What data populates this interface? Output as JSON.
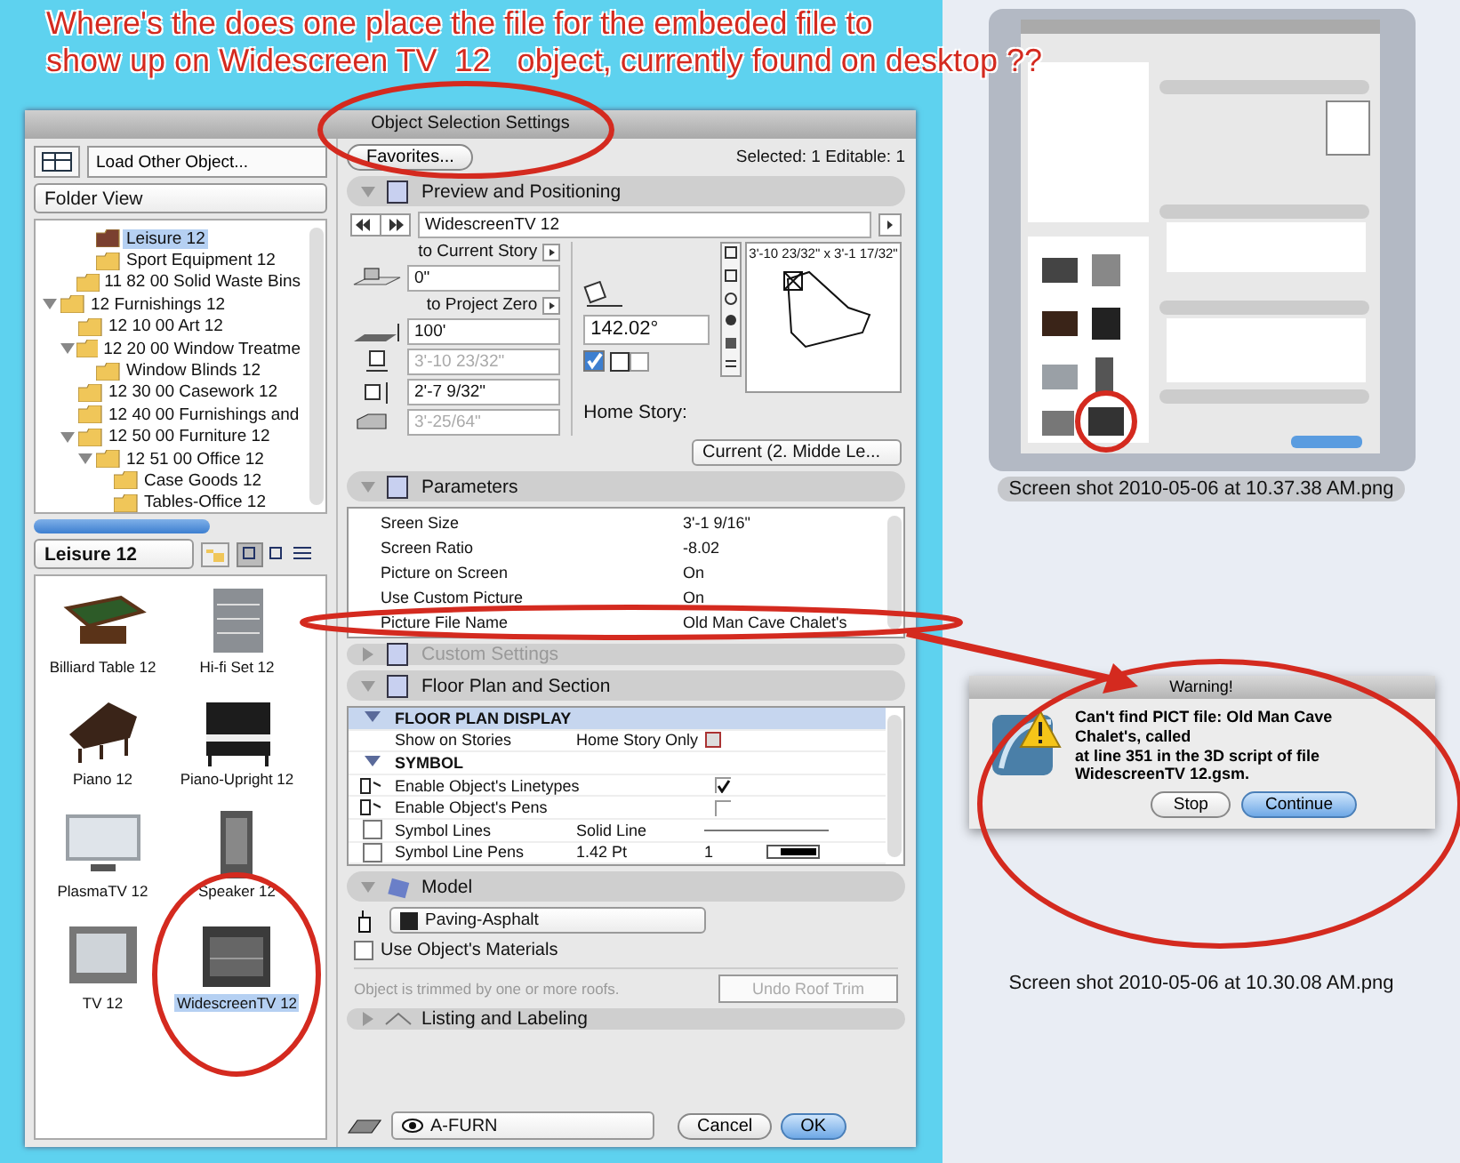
{
  "annotation": {
    "lines": [
      "Where's the does one place the file for the embeded file to",
      "show up on Widescreen TV  12   object, currently found on desktop ??"
    ]
  },
  "dialog": {
    "title": "Object Selection Settings",
    "load_button": "Load Other Object...",
    "view_select": "Folder View",
    "tree": [
      {
        "children": [
          {
            "children": [
              {
                "label": "Leisure 12",
                "kind": "library",
                "selected": true
              },
              {
                "label": "Sport Equipment 12",
                "kind": "folder",
                "selected": false
              }
            ]
          },
          {
            "label": "11 82 00 Solid Waste Bins",
            "kind": "folder",
            "selected": false
          }
        ]
      },
      {
        "label": "12 Furnishings 12",
        "kind": "folder",
        "selected": false,
        "expanded": true,
        "children": [
          {
            "label": "12 10 00 Art 12",
            "kind": "folder",
            "selected": false
          },
          {
            "label": "12 20 00 Window Treatme",
            "kind": "folder",
            "selected": false,
            "expanded": true,
            "children": [
              {
                "label": "Window Blinds 12",
                "kind": "folder",
                "selected": false
              }
            ]
          },
          {
            "label": "12 30 00 Casework 12",
            "kind": "folder",
            "selected": false
          },
          {
            "label": "12 40 00 Furnishings and",
            "kind": "folder",
            "selected": false
          },
          {
            "label": "12 50 00 Furniture 12",
            "kind": "folder",
            "selected": false,
            "expanded": true,
            "children": [
              {
                "label": "12 51 00 Office 12",
                "kind": "folder",
                "selected": false,
                "expanded": true,
                "children": [
                  {
                    "label": "Case Goods 12",
                    "kind": "folder",
                    "selected": false
                  },
                  {
                    "label": "Tables-Office 12",
                    "kind": "folder",
                    "selected": false
                  }
                ]
              }
            ]
          }
        ]
      }
    ],
    "folder_select": "Leisure 12",
    "objects": [
      {
        "label": "Billiard Table 12",
        "kind": "billiard",
        "selected": false
      },
      {
        "label": "Hi-fi Set 12",
        "kind": "hifi",
        "selected": false
      },
      {
        "label": "Piano 12",
        "kind": "piano",
        "selected": false
      },
      {
        "label": "Piano-Upright 12",
        "kind": "upright",
        "selected": false
      },
      {
        "label": "PlasmaTV 12",
        "kind": "plasma",
        "selected": false
      },
      {
        "label": "Speaker 12",
        "kind": "speaker",
        "selected": false
      },
      {
        "label": "TV 12",
        "kind": "tv",
        "selected": false
      },
      {
        "label": "WidescreenTV 12",
        "kind": "widescreen",
        "selected": true
      }
    ],
    "favorites_button": "Favorites...",
    "selection_info": "Selected: 1 Editable: 1",
    "sections": [
      {
        "kind": "preview",
        "title": "Preview and Positioning",
        "expanded": true,
        "disabled": false,
        "object_name": "WidescreenTV 12",
        "story_label": "to Current Story",
        "story_offset": "0\"",
        "zero_label": "to Project Zero",
        "zero_offset": "100'",
        "width": {
          "value": "3'-10 23/32\"",
          "disabled": true
        },
        "depth": {
          "value": "2'-7 9/32\"",
          "disabled": false
        },
        "height": {
          "value": "3'-25/64\"",
          "disabled": true
        },
        "angle": "142.02°",
        "mirrored": true,
        "home_story_label": "Home Story:",
        "home_story": "Current (2. Midde Le...",
        "preview_size": "3'-10 23/32\" x 3'-1 17/32\""
      },
      {
        "kind": "parameters",
        "title": "Parameters",
        "expanded": true,
        "disabled": false,
        "rows": [
          {
            "name": "Sreen Size",
            "value": "3'-1 9/16\""
          },
          {
            "name": "Screen Ratio",
            "value": "-8.02"
          },
          {
            "name": "Picture on Screen",
            "value": "On"
          },
          {
            "name": "Use Custom Picture",
            "value": "On"
          },
          {
            "name": "Picture File Name",
            "value": "Old Man Cave Chalet's"
          }
        ]
      },
      {
        "kind": "custom",
        "title": "Custom Settings",
        "expanded": false,
        "disabled": true
      },
      {
        "kind": "floor_plan",
        "title": "Floor Plan and Section",
        "expanded": true,
        "disabled": false,
        "rows": [
          {
            "kind": "group",
            "label": "FLOOR PLAN DISPLAY",
            "expanded": true,
            "selected": true
          },
          {
            "kind": "value",
            "label": "Show on Stories",
            "value": "Home Story Only",
            "selected": false
          },
          {
            "kind": "group",
            "label": "SYMBOL",
            "expanded": true,
            "selected": false
          },
          {
            "kind": "check",
            "label": "Enable Object's Linetypes",
            "checked": true,
            "selected": false
          },
          {
            "kind": "check",
            "label": "Enable Object's Pens",
            "checked": false,
            "selected": false
          },
          {
            "kind": "line",
            "label": "Symbol Lines",
            "value": "Solid Line",
            "selected": false
          },
          {
            "kind": "pen",
            "label": "Symbol Line Pens",
            "value": "1.42 Pt",
            "pen": "1",
            "selected": false
          }
        ]
      },
      {
        "kind": "model",
        "title": "Model",
        "expanded": true,
        "disabled": false,
        "surface": "Paving-Asphalt",
        "use_materials": {
          "label": "Use Object's Materials",
          "checked": false
        },
        "trim_note": "Object is trimmed by one or more roofs.",
        "trim_button": {
          "label": "Undo Roof Trim",
          "disabled": true
        }
      },
      {
        "kind": "listing",
        "title": "Listing and Labeling",
        "expanded": false,
        "disabled": false
      }
    ],
    "layer": "A-FURN",
    "cancel": "Cancel",
    "ok": "OK"
  },
  "files": [
    {
      "kind": "dialog_thumbnail",
      "caption": "Screen shot 2010-05-06 at 10.37.38 AM.png",
      "selected": true
    },
    {
      "kind": "warning",
      "caption": "Screen shot 2010-05-06 at 10.30.08 AM.png",
      "selected": false,
      "warning": {
        "title": "Warning!",
        "message": "Can't find PICT file: Old Man Cave Chalet's, called\n at line 351 in the 3D script of file WidescreenTV 12.gsm.",
        "buttons": [
          {
            "label": "Stop",
            "default": false
          },
          {
            "label": "Continue",
            "default": true
          }
        ]
      }
    }
  ]
}
